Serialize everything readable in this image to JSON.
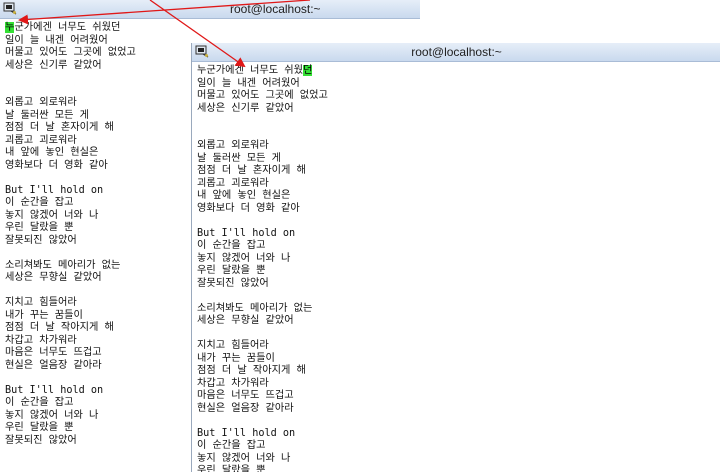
{
  "windows": [
    {
      "title": "root@localhost:~",
      "lines": [
        [
          "",
          "누",
          "군가에겐 너무도 쉬웠던"
        ],
        [
          "일이 늘 내겐 어려웠어"
        ],
        [
          "머물고 있어도 그곳에 없었고"
        ],
        [
          "세상은 신기루 같았어"
        ],
        [
          ""
        ],
        [
          ""
        ],
        [
          "외롭고 외로워라"
        ],
        [
          "날 둘러싼 모든 게"
        ],
        [
          "점점 더 날 혼자이게 해"
        ],
        [
          "괴롭고 괴로워라"
        ],
        [
          "내 앞에 놓인 현실은"
        ],
        [
          "영화보다 더 영화 같아"
        ],
        [
          ""
        ],
        [
          "But I'll hold on"
        ],
        [
          "이 순간을 잡고"
        ],
        [
          "놓지 않겠어 너와 나"
        ],
        [
          "우린 달랐을 뿐"
        ],
        [
          "잘못되진 않았어"
        ],
        [
          ""
        ],
        [
          "소리쳐봐도 메아리가 없는"
        ],
        [
          "세상은 무향실 같았어"
        ],
        [
          ""
        ],
        [
          "지치고 힘들어라"
        ],
        [
          "내가 꾸는 꿈들이"
        ],
        [
          "점점 더 날 작아지게 해"
        ],
        [
          "차갑고 차가워라"
        ],
        [
          "마음은 너무도 뜨겁고"
        ],
        [
          "현실은 얼음장 같아라"
        ],
        [
          ""
        ],
        [
          "But I'll hold on"
        ],
        [
          "이 순간을 잡고"
        ],
        [
          "놓지 않겠어 너와 나"
        ],
        [
          "우린 달랐을 뿐"
        ],
        [
          "잘못되진 않았어"
        ]
      ]
    },
    {
      "title": "root@localhost:~",
      "lines": [
        [
          "누군가에겐 너무도 쉬웠",
          "던",
          ""
        ],
        [
          "일이 늘 내겐 어려웠어"
        ],
        [
          "머물고 있어도 그곳에 없었고"
        ],
        [
          "세상은 신기루 같았어"
        ],
        [
          ""
        ],
        [
          ""
        ],
        [
          "외롭고 외로워라"
        ],
        [
          "날 둘러싼 모든 게"
        ],
        [
          "점점 더 날 혼자이게 해"
        ],
        [
          "괴롭고 괴로워라"
        ],
        [
          "내 앞에 놓인 현실은"
        ],
        [
          "영화보다 더 영화 같아"
        ],
        [
          ""
        ],
        [
          "But I'll hold on"
        ],
        [
          "이 순간을 잡고"
        ],
        [
          "놓지 않겠어 너와 나"
        ],
        [
          "우린 달랐을 뿐"
        ],
        [
          "잘못되진 않았어"
        ],
        [
          ""
        ],
        [
          "소리쳐봐도 메아리가 없는"
        ],
        [
          "세상은 무향실 같았어"
        ],
        [
          ""
        ],
        [
          "지치고 힘들어라"
        ],
        [
          "내가 꾸는 꿈들이"
        ],
        [
          "점점 더 날 작아지게 해"
        ],
        [
          "차갑고 차가워라"
        ],
        [
          "마음은 너무도 뜨겁고"
        ],
        [
          "현실은 얼음장 같아라"
        ],
        [
          ""
        ],
        [
          "But I'll hold on"
        ],
        [
          "이 순간을 잡고"
        ],
        [
          "놓지 않겠어 너와 나"
        ],
        [
          "우린 달랐을 뿐"
        ]
      ]
    }
  ],
  "icons": {
    "window": "putty-terminal-icon"
  },
  "colors": {
    "cursor_highlight": "#35e035",
    "annotation_arrow": "#e01818"
  }
}
